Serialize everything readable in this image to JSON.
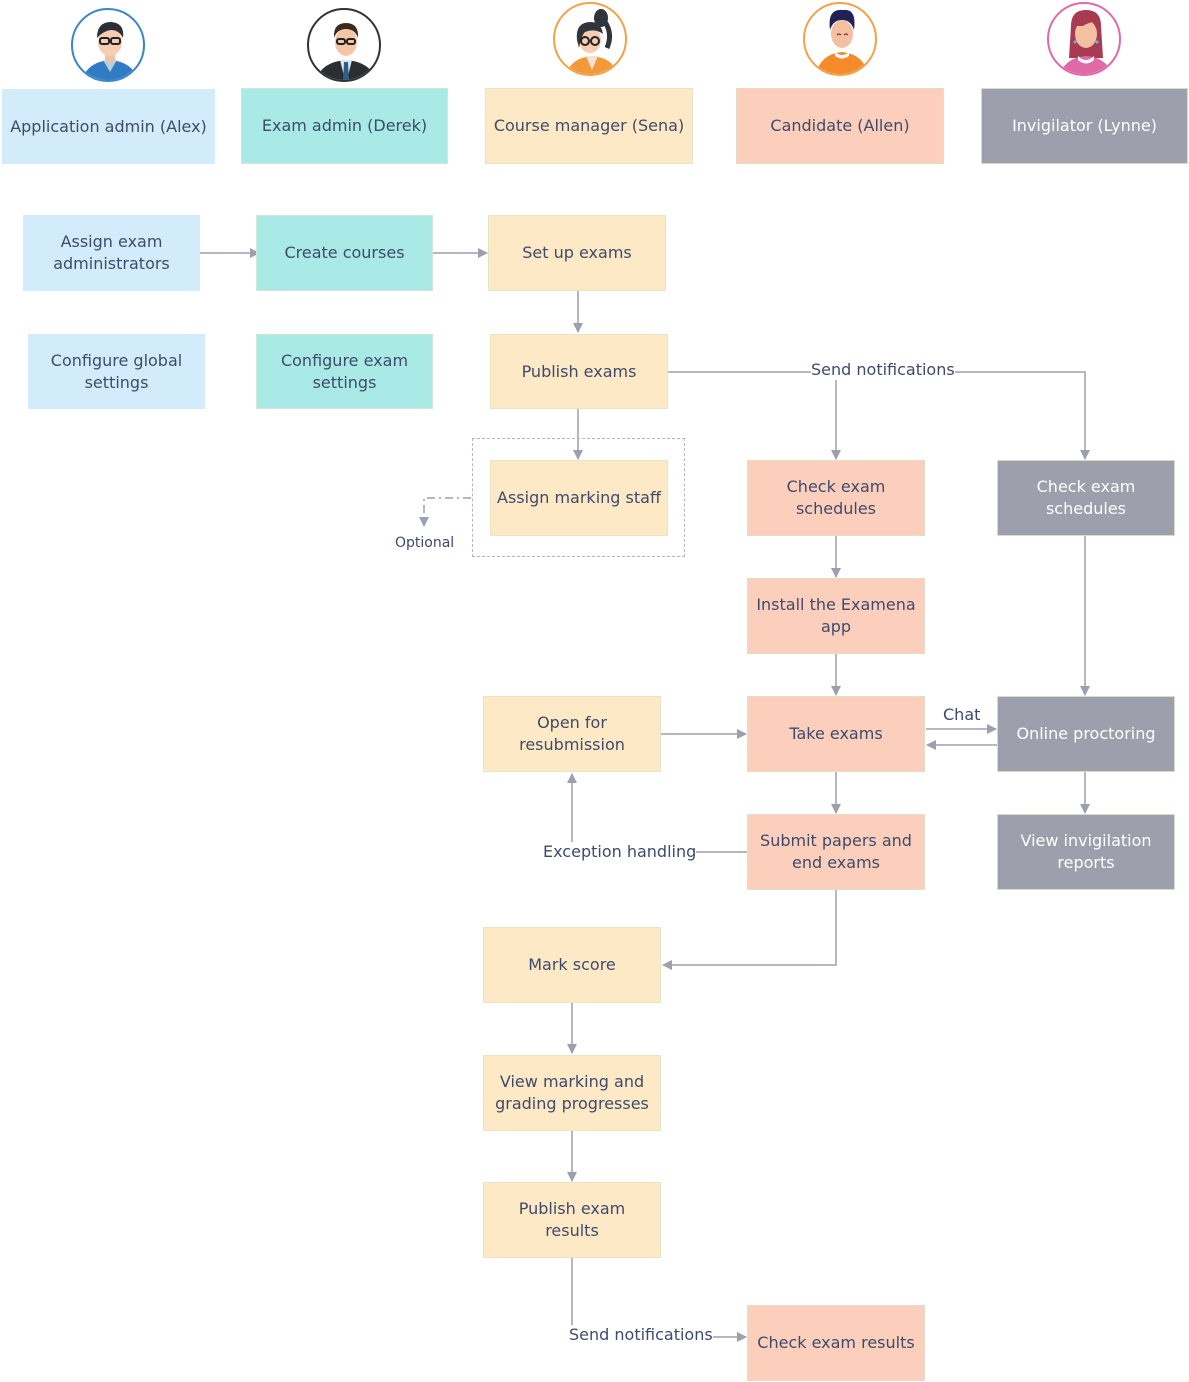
{
  "roles": [
    {
      "label": "Application admin (Alex)",
      "avatar": "admin-man-glasses-avatar",
      "color": "#d2ecfb",
      "ring": "#3a86c8"
    },
    {
      "label": "Exam admin (Derek)",
      "avatar": "businessman-suit-avatar",
      "color": "#a9eae6",
      "ring": "#333333"
    },
    {
      "label": "Course manager (Sena)",
      "avatar": "woman-ponytail-glasses-avatar",
      "color": "#fde9c6",
      "ring": "#f2a24a"
    },
    {
      "label": "Candidate (Allen)",
      "avatar": "young-man-orange-shirt-avatar",
      "color": "#fccfbd",
      "ring": "#f2a24a"
    },
    {
      "label": "Invigilator (Lynne)",
      "avatar": "woman-pink-dress-avatar",
      "color": "#9d9fac",
      "ring": "#e06aa8"
    }
  ],
  "nodes": {
    "assign_exam_admins": "Assign exam administrators",
    "configure_global": "Configure global settings",
    "create_courses": "Create courses",
    "configure_exam_settings": "Configure exam settings",
    "set_up_exams": "Set up exams",
    "publish_exams": "Publish exams",
    "assign_marking_staff": "Assign marking staff",
    "check_schedules_candidate": "Check exam schedules",
    "install_app": "Install the Examena app",
    "take_exams": "Take exams",
    "submit_papers": "Submit papers and end exams",
    "open_resubmission": "Open for resubmission",
    "mark_score": "Mark score",
    "view_marking": "View marking and grading progresses",
    "publish_results": "Publish exam results",
    "check_results": "Check exam results",
    "check_schedules_invigilator": "Check exam schedules",
    "online_proctoring": "Online proctoring",
    "view_reports": "View invigilation reports"
  },
  "edge_labels": {
    "send_notifications_1": "Send notifications",
    "optional": "Optional",
    "chat": "Chat",
    "exception_handling": "Exception handling",
    "send_notifications_2": "Send notifications"
  },
  "colors": {
    "connector": "#9d9fac",
    "text": "#3f4a6b"
  }
}
